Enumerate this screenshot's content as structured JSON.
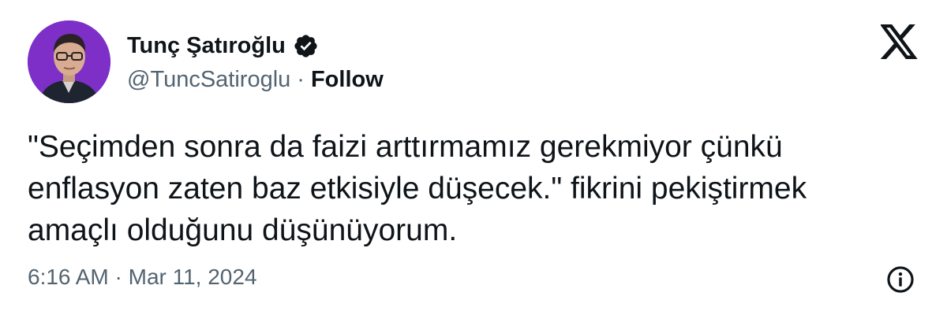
{
  "author": {
    "display_name": "Tunç Şatıroğlu",
    "handle": "@TuncSatiroglu",
    "separator": "·",
    "follow_label": "Follow",
    "verified_icon": "verified-badge-icon",
    "avatar_bg": "#7d2fc8"
  },
  "tweet": {
    "text": "\"Seçimden sonra da faizi arttırmamız gerekmiyor çünkü\nenflasyon zaten baz etkisiyle düşecek.\" fikrini pekiştirmek\namaçlı olduğunu düşünüyorum.",
    "timestamp": "6:16 AM · Mar 11, 2024"
  },
  "icons": {
    "brand": "x-logo-icon",
    "info": "info-icon"
  },
  "colors": {
    "text_primary": "#0f1419",
    "text_secondary": "#536471",
    "background": "#ffffff"
  }
}
